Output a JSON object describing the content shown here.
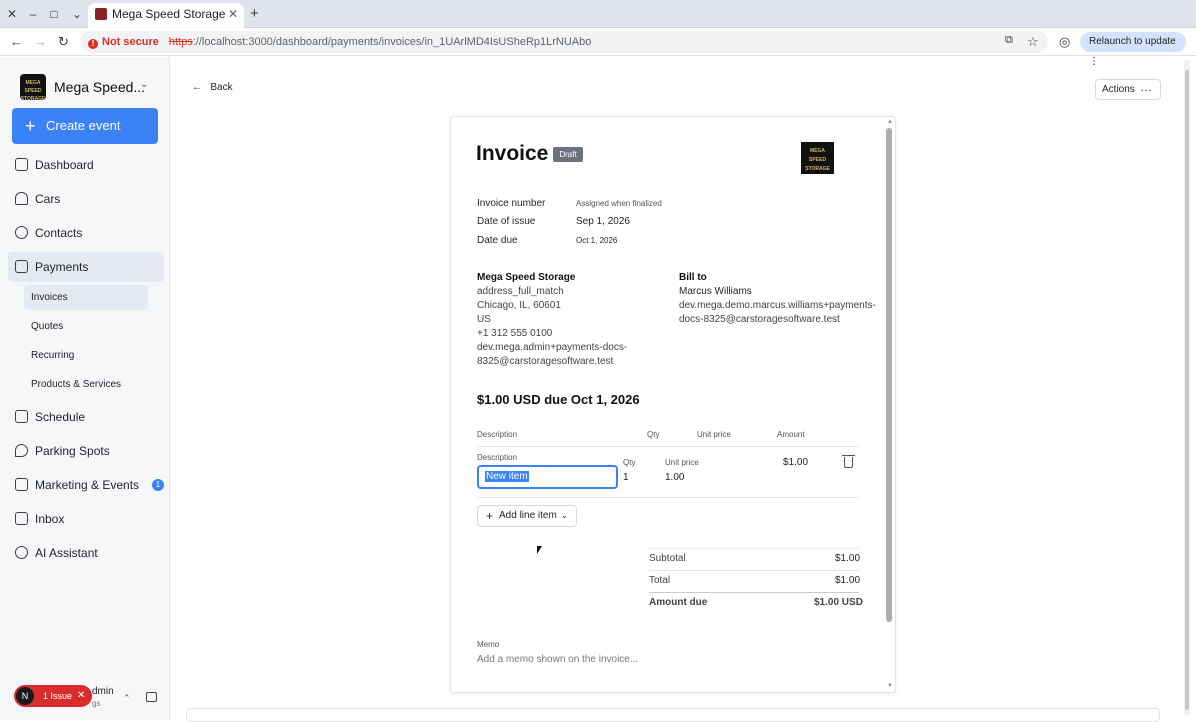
{
  "browser": {
    "tab_title": "Mega Speed Storage",
    "not_secure": "Not secure",
    "url_scheme": "https",
    "url_rest": "://localhost:3000/dashboard/payments/invoices/in_1UArlMD4IsUSheRp1LrNUAbo",
    "relaunch": "Relaunch to update"
  },
  "sidebar": {
    "brand": "Mega Speed...",
    "brand_logo_text": "MEGA SPEED STORAGE",
    "create_event": "Create event",
    "items": [
      {
        "label": "Dashboard"
      },
      {
        "label": "Cars"
      },
      {
        "label": "Contacts"
      },
      {
        "label": "Payments"
      },
      {
        "label": "Schedule"
      },
      {
        "label": "Parking Spots"
      },
      {
        "label": "Marketing & Events",
        "badge": "1"
      },
      {
        "label": "Inbox"
      },
      {
        "label": "AI Assistant"
      }
    ],
    "sub_items": [
      {
        "label": "Invoices"
      },
      {
        "label": "Quotes"
      },
      {
        "label": "Recurring"
      },
      {
        "label": "Products & Services"
      }
    ],
    "issue_avatar": "N",
    "issue_label": "1 Issue",
    "user_name": "dmin",
    "user_sub": "gs"
  },
  "header": {
    "back": "Back",
    "actions": "Actions"
  },
  "invoice": {
    "title": "Invoice",
    "status": "Draft",
    "logo_text": "MEGA SPEED STORAGE",
    "number_label": "Invoice number",
    "number_value": "Assigned when finalized",
    "issue_label": "Date of issue",
    "issue_value": "Sep 1, 2026",
    "due_label": "Date due",
    "due_value": "Oct 1, 2026",
    "from": {
      "name": "Mega Speed Storage",
      "line1": "address_full_match",
      "line2": "Chicago, IL, 60601",
      "line3": "US",
      "phone": "+1 312 555 0100",
      "email1": "dev.mega.admin+payments-docs-",
      "email2": "8325@carstoragesoftware.test"
    },
    "bill_to": {
      "label": "Bill to",
      "name": "Marcus Williams",
      "email1": "dev.mega.demo.marcus.williams+payments-",
      "email2": "docs-8325@carstoragesoftware.test"
    },
    "due_headline": "$1.00 USD due Oct 1, 2026",
    "table_headers": {
      "description": "Description",
      "qty": "Qty",
      "unit_price": "Unit price",
      "amount": "Amount"
    },
    "line": {
      "description_label": "Description",
      "description_value": "New item",
      "qty_label": "Qty",
      "qty_value": "1",
      "unit_label": "Unit price",
      "unit_value": "1.00",
      "amount": "$1.00"
    },
    "add_line": "Add line item",
    "subtotal_label": "Subtotal",
    "subtotal_value": "$1.00",
    "total_label": "Total",
    "total_value": "$1.00",
    "amount_due_label": "Amount due",
    "amount_due_value": "$1.00 USD",
    "memo_label": "Memo",
    "memo_placeholder": "Add a memo shown on the invoice..."
  }
}
